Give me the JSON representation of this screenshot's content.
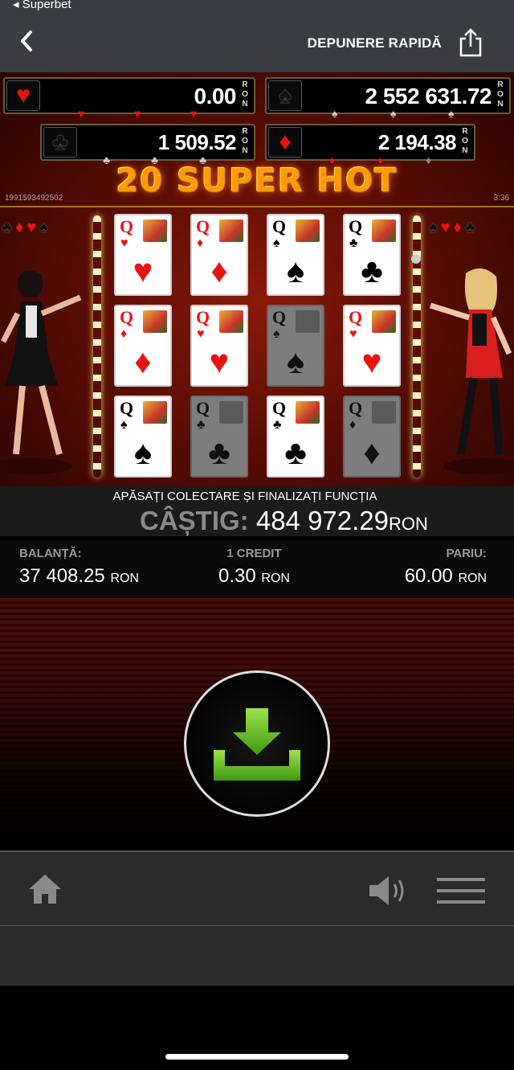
{
  "status": {
    "back_app": "◂ Superbet"
  },
  "nav": {
    "title": "DEPUNERE RAPIDĂ",
    "back_icon": "chevron-left-icon",
    "share_icon": "share-icon"
  },
  "jackpots": {
    "hearts": {
      "value": "0.00",
      "currency": "RON",
      "symbol": "♥"
    },
    "spades": {
      "value": "2 552 631.72",
      "currency": "RON",
      "symbol": "♠"
    },
    "clubs": {
      "value": "1 509.52",
      "currency": "RON",
      "symbol": "♣"
    },
    "diamonds": {
      "value": "2 194.38",
      "currency": "RON",
      "symbol": "♦"
    }
  },
  "game": {
    "logo": "20 SUPER HOT",
    "id": "1991593492502",
    "time": "3:36",
    "reels": [
      [
        {
          "rank": "Q",
          "suit": "♥",
          "color": "red",
          "dim": false
        },
        {
          "rank": "Q",
          "suit": "♦",
          "color": "red",
          "dim": false
        },
        {
          "rank": "Q",
          "suit": "♠",
          "color": "blk",
          "dim": false
        }
      ],
      [
        {
          "rank": "Q",
          "suit": "♦",
          "color": "red",
          "dim": false
        },
        {
          "rank": "Q",
          "suit": "♥",
          "color": "red",
          "dim": false
        },
        {
          "rank": "Q",
          "suit": "♣",
          "color": "blk",
          "dim": true
        }
      ],
      [
        {
          "rank": "Q",
          "suit": "♠",
          "color": "blk",
          "dim": false
        },
        {
          "rank": "Q",
          "suit": "♠",
          "color": "blk",
          "dim": true
        },
        {
          "rank": "Q",
          "suit": "♣",
          "color": "blk",
          "dim": false
        }
      ],
      [
        {
          "rank": "Q",
          "suit": "♣",
          "color": "blk",
          "dim": false
        },
        {
          "rank": "Q",
          "suit": "♥",
          "color": "red",
          "dim": false
        },
        {
          "rank": "Q",
          "suit": "♦",
          "color": "blk",
          "dim": true
        }
      ]
    ]
  },
  "info": {
    "hint": "APĂSAȚI COLECTARE ȘI FINALIZAȚI FUNCȚIA",
    "win_label": "CÂȘTIG:",
    "win_amount": "484 972.29",
    "win_currency": "RON"
  },
  "balance": {
    "balance_label": "BALANȚĂ:",
    "balance_value": "37 408.25",
    "balance_currency": "RON",
    "credit_label": "1 CREDIT",
    "credit_value": "0.30",
    "credit_currency": "RON",
    "bet_label": "PARIU:",
    "bet_value": "60.00",
    "bet_currency": "RON"
  },
  "controls": {
    "collect_icon": "download-icon",
    "home_icon": "home-icon",
    "sound_icon": "speaker-icon",
    "menu_icon": "hamburger-menu-icon"
  },
  "colors": {
    "accent_green": "#5fc01e",
    "suit_red": "#e81313",
    "gold": "#caa03a"
  }
}
